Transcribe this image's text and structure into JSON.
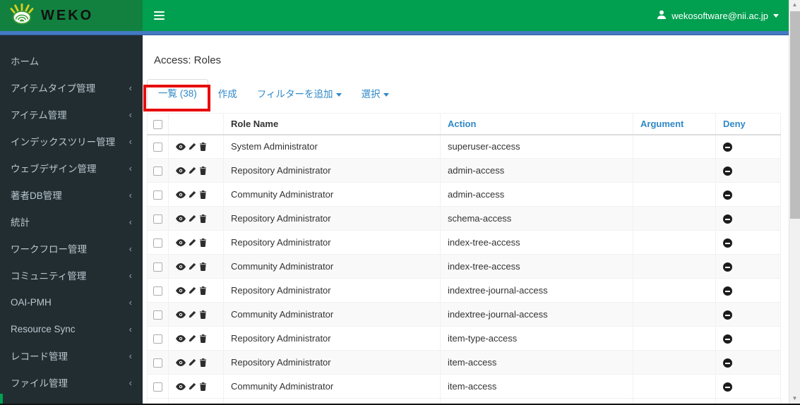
{
  "colors": {
    "brand-green": "#12813f",
    "nav-green": "#00a050",
    "strip-blue": "#4479c4",
    "sidebar-bg": "#222d32",
    "sidebar-text": "#b8c7ce",
    "link-blue": "#3088c7",
    "annotation-red": "#e80c0c",
    "text-dark": "#333333",
    "deny-dark": "#1c1c1c",
    "stripe-gray": "#f9f9f9"
  },
  "navbar": {
    "brand": "WEKO",
    "user_email": "wekosoftware@nii.ac.jp"
  },
  "icons": {
    "hamburger": "hamburger-menu",
    "user": "person-silhouette",
    "caret_down": "caret-down-triangle",
    "submenu_chevron": "‹",
    "view": "eye",
    "edit": "pencil",
    "delete": "trash",
    "deny": "minus-circle",
    "scroll_up": "▲",
    "scroll_down": "▼"
  },
  "sidebar": {
    "items": [
      {
        "name": "sidebar-item-home",
        "label": "ホーム",
        "has_submenu": false
      },
      {
        "name": "sidebar-item-item-type-mgmt",
        "label": "アイテムタイプ管理",
        "has_submenu": true
      },
      {
        "name": "sidebar-item-item-mgmt",
        "label": "アイテム管理",
        "has_submenu": true
      },
      {
        "name": "sidebar-item-index-tree-mgmt",
        "label": "インデックスツリー管理",
        "has_submenu": true
      },
      {
        "name": "sidebar-item-web-design-mgmt",
        "label": "ウェブデザイン管理",
        "has_submenu": true
      },
      {
        "name": "sidebar-item-author-db-mgmt",
        "label": "著者DB管理",
        "has_submenu": true
      },
      {
        "name": "sidebar-item-statistics",
        "label": "統計",
        "has_submenu": true
      },
      {
        "name": "sidebar-item-workflow-mgmt",
        "label": "ワークフロー管理",
        "has_submenu": true
      },
      {
        "name": "sidebar-item-community-mgmt",
        "label": "コミュニティ管理",
        "has_submenu": true
      },
      {
        "name": "sidebar-item-oai-pmh",
        "label": "OAI-PMH",
        "has_submenu": true
      },
      {
        "name": "sidebar-item-resource-sync",
        "label": "Resource Sync",
        "has_submenu": true
      },
      {
        "name": "sidebar-item-record-mgmt",
        "label": "レコード管理",
        "has_submenu": true
      },
      {
        "name": "sidebar-item-file-mgmt",
        "label": "ファイル管理",
        "has_submenu": true
      }
    ]
  },
  "main": {
    "page_title": "Access: Roles",
    "tabs": {
      "list": {
        "label": "一覧 (38)",
        "count": 38
      },
      "create": {
        "label": "作成"
      },
      "add_filter": {
        "label": "フィルターを追加"
      },
      "select": {
        "label": "選択"
      }
    },
    "table": {
      "columns": {
        "role_name": "Role Name",
        "action": "Action",
        "argument": "Argument",
        "deny": "Deny"
      },
      "rows": [
        {
          "role": "System Administrator",
          "action": "superuser-access",
          "argument": "",
          "deny": true
        },
        {
          "role": "Repository Administrator",
          "action": "admin-access",
          "argument": "",
          "deny": true
        },
        {
          "role": "Community Administrator",
          "action": "admin-access",
          "argument": "",
          "deny": true
        },
        {
          "role": "Repository Administrator",
          "action": "schema-access",
          "argument": "",
          "deny": true
        },
        {
          "role": "Repository Administrator",
          "action": "index-tree-access",
          "argument": "",
          "deny": true
        },
        {
          "role": "Community Administrator",
          "action": "index-tree-access",
          "argument": "",
          "deny": true
        },
        {
          "role": "Repository Administrator",
          "action": "indextree-journal-access",
          "argument": "",
          "deny": true
        },
        {
          "role": "Community Administrator",
          "action": "indextree-journal-access",
          "argument": "",
          "deny": true
        },
        {
          "role": "Repository Administrator",
          "action": "item-type-access",
          "argument": "",
          "deny": true
        },
        {
          "role": "Repository Administrator",
          "action": "item-access",
          "argument": "",
          "deny": true
        },
        {
          "role": "Community Administrator",
          "action": "item-access",
          "argument": "",
          "deny": true
        }
      ]
    }
  }
}
